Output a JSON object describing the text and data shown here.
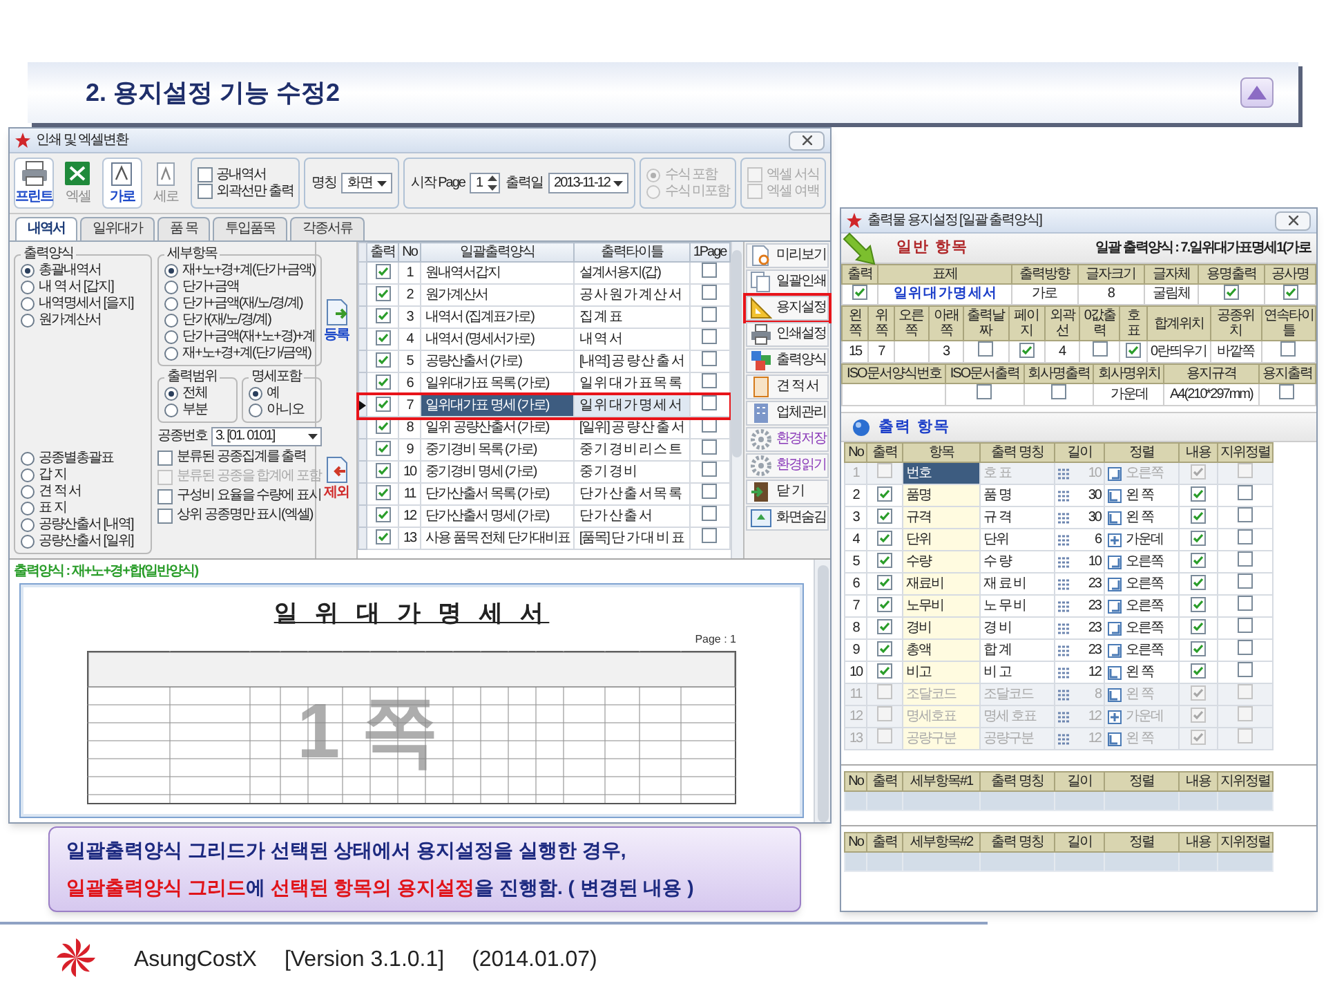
{
  "slide": {
    "title": "2. 용지설정 기능 수정2",
    "footer": {
      "product": "AsungCostX",
      "version": "[Version 3.1.0.1]",
      "date": "(2014.01.07)"
    }
  },
  "print_window": {
    "title": "인쇄 및 엑셀변환",
    "toolbar": [
      {
        "kind": "print",
        "label": "프린트",
        "selected": true
      },
      {
        "kind": "excel",
        "label": "엑셀",
        "selected": false
      },
      {
        "kind": "landscape",
        "label": "가로",
        "selected": true
      },
      {
        "kind": "portrait",
        "label": "세로",
        "selected": false
      }
    ],
    "options": [
      {
        "label": "공내역서",
        "checked": false
      },
      {
        "label": "외곽선만 출력",
        "checked": false
      }
    ],
    "name_field": {
      "label": "명칭",
      "value": "화면"
    },
    "start_page": {
      "label": "시작 Page",
      "value": "1"
    },
    "print_date": {
      "label": "출력일",
      "value": "2013-11-12"
    },
    "formula_options": [
      {
        "label": "수식 포함",
        "selected": true,
        "disabled": true
      },
      {
        "label": "수식 미포함",
        "selected": false,
        "disabled": true
      }
    ],
    "excel_options": [
      {
        "label": "엑셀 서식",
        "checked": false,
        "disabled": true
      },
      {
        "label": "엑셀 여백",
        "checked": false,
        "disabled": true
      }
    ],
    "tabs": [
      {
        "label": "내역서",
        "selected": true
      },
      {
        "label": "일위대가",
        "selected": false
      },
      {
        "label": "품 목",
        "selected": false
      },
      {
        "label": "투입품목",
        "selected": false
      },
      {
        "label": "각종서류",
        "selected": false
      }
    ],
    "output_format": {
      "title": "출력양식",
      "options": [
        {
          "label": "총괄내역서",
          "selected": true
        },
        {
          "label": "내 역 서 [갑지]",
          "selected": false
        },
        {
          "label": "내역명세서 [을지]",
          "selected": false
        },
        {
          "label": "원가계산서",
          "selected": false
        }
      ],
      "more_options": [
        {
          "label": "공종별총괄표",
          "selected": false
        },
        {
          "label": "갑 지",
          "selected": false
        },
        {
          "label": "견 적 서",
          "selected": false
        },
        {
          "label": "표 지",
          "selected": false
        },
        {
          "label": "공량산출서 [내역]",
          "selected": false
        },
        {
          "label": "공량산출서 [일위]",
          "selected": false
        }
      ]
    },
    "detail_items": {
      "title": "세부항목",
      "options": [
        {
          "label": "재+노+경+계(단가+금액)",
          "selected": true
        },
        {
          "label": "단가+금액",
          "selected": false
        },
        {
          "label": "단가+금액(재/노/경/계)",
          "selected": false
        },
        {
          "label": "단가(재/노/경/계)",
          "selected": false
        },
        {
          "label": "단가+금액(재+노+경)+계",
          "selected": false
        },
        {
          "label": "재+노+경+계(단가/금액)",
          "selected": false
        }
      ]
    },
    "range": {
      "title": "출력범위",
      "options": [
        {
          "label": "전체",
          "selected": true
        },
        {
          "label": "부분",
          "selected": false
        }
      ]
    },
    "include_detail": {
      "title": "명세포함",
      "options": [
        {
          "label": "예",
          "selected": true
        },
        {
          "label": "아니오",
          "selected": false
        }
      ]
    },
    "work_number": {
      "label": "공종번호",
      "value": "3. [01. 0101]"
    },
    "checks": [
      {
        "label": "분류된 공종집계를 출력",
        "checked": false,
        "disabled": false
      },
      {
        "label": "분류된 공종을 합계에 포함",
        "checked": false,
        "disabled": true
      },
      {
        "label": "구성비 요율을 수량에 표시",
        "checked": false,
        "disabled": false
      },
      {
        "label": "상위 공종명만 표시(엑셀)",
        "checked": false,
        "disabled": false
      }
    ],
    "add_button": "등록",
    "remove_button": "제외",
    "grid": {
      "columns": [
        "출력",
        "No",
        "일괄출력양식",
        "출력타이틀",
        "1Page"
      ],
      "rows": [
        {
          "checked": true,
          "no": "1",
          "format": "원내역서갑지",
          "title": "설계서용지(갑)",
          "one_page": false,
          "selected": false
        },
        {
          "checked": true,
          "no": "2",
          "format": "원가계산서",
          "title": "공 사 원 가 계 산 서",
          "one_page": false,
          "selected": false
        },
        {
          "checked": true,
          "no": "3",
          "format": "내역서 (집계표가로)",
          "title": "집 계 표",
          "one_page": false,
          "selected": false
        },
        {
          "checked": true,
          "no": "4",
          "format": "내역서 (명세서가로)",
          "title": "내 역 서",
          "one_page": false,
          "selected": false
        },
        {
          "checked": true,
          "no": "5",
          "format": "공량산출서 (가로)",
          "title": "[내역] 공 량 산 출 서",
          "one_page": false,
          "selected": false
        },
        {
          "checked": true,
          "no": "6",
          "format": "일위대가표 목록 (가로)",
          "title": "일 위 대 가 표 목 록",
          "one_page": false,
          "selected": false
        },
        {
          "checked": true,
          "no": "7",
          "format": "일위대가표 명세 (가로)",
          "title": "일 위 대 가 명 세 서",
          "one_page": false,
          "selected": true
        },
        {
          "checked": true,
          "no": "8",
          "format": "일위 공량산출서 (가로)",
          "title": "[일위] 공 량 산 출 서",
          "one_page": false,
          "selected": false
        },
        {
          "checked": true,
          "no": "9",
          "format": "중기경비 목록 (가로)",
          "title": "중 기 경 비 리 스 트",
          "one_page": false,
          "selected": false
        },
        {
          "checked": true,
          "no": "10",
          "format": "중기경비 명세 (가로)",
          "title": "중 기 경 비",
          "one_page": false,
          "selected": false
        },
        {
          "checked": true,
          "no": "11",
          "format": "단가산출서 목록 (가로)",
          "title": "단 가 산 출 서 목 록",
          "one_page": false,
          "selected": false
        },
        {
          "checked": true,
          "no": "12",
          "format": "단가산출서 명세 (가로)",
          "title": "단 가 산 출 서",
          "one_page": false,
          "selected": false
        },
        {
          "checked": true,
          "no": "13",
          "format": "사용 품목 전체 단가대비표",
          "title": "[품목] 단 가 대 비 표",
          "one_page": false,
          "selected": false
        }
      ]
    },
    "side_buttons": [
      {
        "kind": "preview",
        "label": "미리보기",
        "highlighted": false
      },
      {
        "kind": "batch",
        "label": "일괄인쇄",
        "highlighted": false
      },
      {
        "kind": "paper",
        "label": "용지설정",
        "highlighted": true
      },
      {
        "kind": "printer",
        "label": "인쇄설정",
        "highlighted": false
      },
      {
        "kind": "format",
        "label": "출력양식",
        "highlighted": false
      },
      {
        "kind": "estimate",
        "label": "견 적 서",
        "highlighted": false
      },
      {
        "kind": "company",
        "label": "업체관리",
        "highlighted": false
      },
      {
        "kind": "env",
        "label": "환경저장",
        "highlighted": false
      },
      {
        "kind": "env",
        "label": "환경읽기",
        "highlighted": false
      },
      {
        "kind": "close",
        "label": "닫 기",
        "highlighted": false
      },
      {
        "kind": "hide",
        "label": "화면숨김",
        "highlighted": false
      }
    ],
    "preview": {
      "caption": "출력양식 : 재+노+경+합(일반양식)",
      "doc_title": "일 위 대 가 명 세 서",
      "page": "Page : 1",
      "page_mark": "1 쪽"
    }
  },
  "paper_window": {
    "title": "출력물 용지설정 [일괄 출력양식]",
    "general_heading": "일반 항목",
    "format_label": "일괄 출력양식 : 7.일위대가표명세1(가로",
    "field_tables": [
      {
        "columns": [
          "출력",
          "표제",
          "출력방향",
          "글자크기",
          "글자체",
          "용명출력",
          "공사명"
        ],
        "cells": [
          {
            "kind": "check",
            "checked": true
          },
          {
            "kind": "title",
            "value": "일 위 대 가 명 세 서"
          },
          {
            "kind": "text",
            "value": "가로"
          },
          {
            "kind": "text",
            "value": "8"
          },
          {
            "kind": "text",
            "value": "굴림체"
          },
          {
            "kind": "check",
            "checked": true
          },
          {
            "kind": "check",
            "checked": true
          }
        ]
      },
      {
        "columns": [
          "왼쪽",
          "위쪽",
          "오른쪽",
          "아래쪽",
          "출력날짜",
          "페이지",
          "외곽선",
          "0값출력",
          "호표",
          "합계위치",
          "공종위치",
          "연속타이틀"
        ],
        "cells": [
          {
            "kind": "text",
            "value": "15"
          },
          {
            "kind": "text",
            "value": "7"
          },
          {
            "kind": "blank"
          },
          {
            "kind": "text",
            "value": "3"
          },
          {
            "kind": "check",
            "checked": false
          },
          {
            "kind": "check",
            "checked": true
          },
          {
            "kind": "text",
            "value": "4"
          },
          {
            "kind": "check",
            "checked": false
          },
          {
            "kind": "check",
            "checked": true
          },
          {
            "kind": "text",
            "value": "0란띄우기"
          },
          {
            "kind": "text",
            "value": "바깥쪽"
          },
          {
            "kind": "check",
            "checked": false
          }
        ]
      },
      {
        "columns": [
          "ISO문서양식번호",
          "ISO문서출력",
          "회사명출력",
          "회사명위치",
          "용지규격",
          "용지출력"
        ],
        "cells": [
          {
            "kind": "blank"
          },
          {
            "kind": "check",
            "checked": false
          },
          {
            "kind": "check",
            "checked": false
          },
          {
            "kind": "text",
            "value": "가운데"
          },
          {
            "kind": "text",
            "value": "A4(210*297mm)"
          },
          {
            "kind": "check",
            "checked": false
          }
        ]
      }
    ],
    "items_heading": "출력 항목",
    "items_grid": {
      "columns": [
        "No",
        "출력",
        "항목",
        "출력 명칭",
        "길이",
        "정렬",
        "내용",
        "지위정렬"
      ],
      "rows": [
        {
          "no": "1",
          "output": false,
          "item": "번호",
          "name": "호 표",
          "length": "10",
          "kind": "right",
          "align": "오른쪽",
          "content": true,
          "keep": false,
          "disabled": true,
          "selected": true
        },
        {
          "no": "2",
          "output": true,
          "item": "품명",
          "name": "품 명",
          "length": "30",
          "kind": "left",
          "align": "왼 쪽",
          "content": true,
          "keep": false,
          "disabled": false,
          "selected": false
        },
        {
          "no": "3",
          "output": true,
          "item": "규격",
          "name": "규 격",
          "length": "30",
          "kind": "left",
          "align": "왼 쪽",
          "content": true,
          "keep": false,
          "disabled": false,
          "selected": false
        },
        {
          "no": "4",
          "output": true,
          "item": "단위",
          "name": "단위",
          "length": "6",
          "kind": "center",
          "align": "가운데",
          "content": true,
          "keep": false,
          "disabled": false,
          "selected": false
        },
        {
          "no": "5",
          "output": true,
          "item": "수량",
          "name": "수 량",
          "length": "10",
          "kind": "right",
          "align": "오른쪽",
          "content": true,
          "keep": false,
          "disabled": false,
          "selected": false
        },
        {
          "no": "6",
          "output": true,
          "item": "재료비",
          "name": "재 료 비",
          "length": "23",
          "kind": "right",
          "align": "오른쪽",
          "content": true,
          "keep": false,
          "disabled": false,
          "selected": false
        },
        {
          "no": "7",
          "output": true,
          "item": "노무비",
          "name": "노 무 비",
          "length": "23",
          "kind": "right",
          "align": "오른쪽",
          "content": true,
          "keep": false,
          "disabled": false,
          "selected": false
        },
        {
          "no": "8",
          "output": true,
          "item": "경비",
          "name": "경 비",
          "length": "23",
          "kind": "right",
          "align": "오른쪽",
          "content": true,
          "keep": false,
          "disabled": false,
          "selected": false
        },
        {
          "no": "9",
          "output": true,
          "item": "총액",
          "name": "합 계",
          "length": "23",
          "kind": "right",
          "align": "오른쪽",
          "content": true,
          "keep": false,
          "disabled": false,
          "selected": false
        },
        {
          "no": "10",
          "output": true,
          "item": "비고",
          "name": "비 고",
          "length": "12",
          "kind": "left",
          "align": "왼 쪽",
          "content": true,
          "keep": false,
          "disabled": false,
          "selected": false
        },
        {
          "no": "11",
          "output": false,
          "item": "조달코드",
          "name": "조달코드",
          "length": "8",
          "kind": "left",
          "align": "왼 쪽",
          "content": true,
          "keep": false,
          "disabled": true,
          "selected": false
        },
        {
          "no": "12",
          "output": false,
          "item": "명세호표",
          "name": "명세 호표",
          "length": "12",
          "kind": "center",
          "align": "가운데",
          "content": true,
          "keep": false,
          "disabled": true,
          "selected": false
        },
        {
          "no": "13",
          "output": false,
          "item": "공량구분",
          "name": "공량구분",
          "length": "12",
          "kind": "left",
          "align": "왼 쪽",
          "content": true,
          "keep": false,
          "disabled": true,
          "selected": false
        }
      ]
    },
    "detail_grids": [
      {
        "columns": [
          "No",
          "출력",
          "세부항목#1",
          "출력 명칭",
          "길이",
          "정렬",
          "내용",
          "지위정렬"
        ]
      },
      {
        "columns": [
          "No",
          "출력",
          "세부항목#2",
          "출력 명칭",
          "길이",
          "정렬",
          "내용",
          "지위정렬"
        ]
      }
    ]
  },
  "callout": {
    "lines": [
      {
        "segments": [
          {
            "kind": "plain",
            "text": "일괄출력양식 그리드가 선택된 상태에서 용지설정을 실행한 경우,"
          }
        ]
      },
      {
        "segments": [
          {
            "kind": "highlight",
            "text": "일괄출력양식 그리드"
          },
          {
            "kind": "plain",
            "text": "에 "
          },
          {
            "kind": "highlight",
            "text": "선택된 항목의 용지설정"
          },
          {
            "kind": "plain",
            "text": "을 진행함. ( 변경된 내용 )"
          }
        ]
      }
    ]
  }
}
